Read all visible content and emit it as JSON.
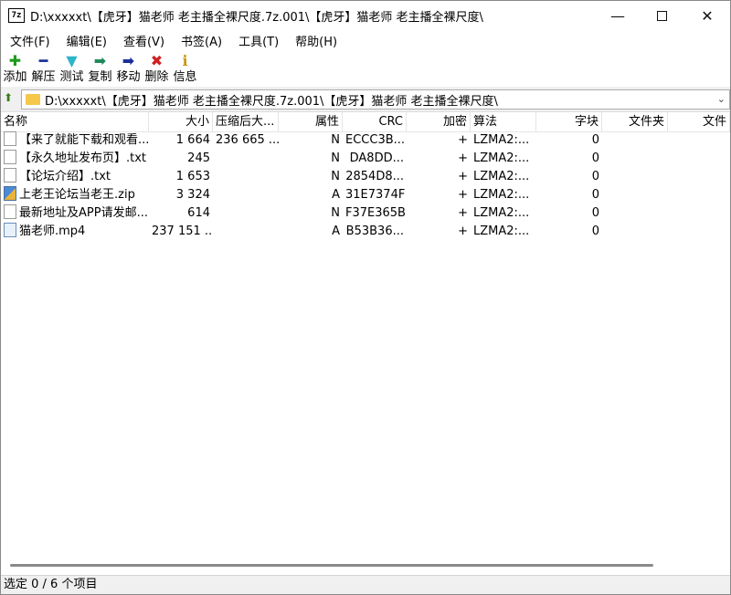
{
  "window": {
    "app_icon": "7z",
    "title": "D:\\xxxxxt\\【虎牙】猫老师 老主播全裸尺度.7z.001\\【虎牙】猫老师 老主播全裸尺度\\",
    "minimize_icon": "minimize-icon",
    "maximize_icon": "maximize-icon",
    "close_icon": "close-icon"
  },
  "menu": [
    "文件(F)",
    "编辑(E)",
    "查看(V)",
    "书签(A)",
    "工具(T)",
    "帮助(H)"
  ],
  "toolbar": [
    {
      "label": "添加",
      "icon": "plus-icon",
      "glyph": "✚",
      "color": "#1e9a1e"
    },
    {
      "label": "解压",
      "icon": "minus-icon",
      "glyph": "━",
      "color": "#1a2f9a"
    },
    {
      "label": "测试",
      "icon": "check-icon",
      "glyph": "▼",
      "color": "#2fb4c8"
    },
    {
      "label": "复制",
      "icon": "copy-arrow-icon",
      "glyph": "➡",
      "color": "#1e8a5a"
    },
    {
      "label": "移动",
      "icon": "move-arrow-icon",
      "glyph": "➡",
      "color": "#1a2f9a"
    },
    {
      "label": "删除",
      "icon": "delete-icon",
      "glyph": "✖",
      "color": "#d02020"
    },
    {
      "label": "信息",
      "icon": "info-icon",
      "glyph": "ℹ",
      "color": "#c89a10"
    }
  ],
  "address": {
    "path": "D:\\xxxxxt\\【虎牙】猫老师 老主播全裸尺度.7z.001\\【虎牙】猫老师 老主播全裸尺度\\"
  },
  "columns": [
    "名称",
    "大小",
    "压缩后大...",
    "属性",
    "CRC",
    "加密",
    "算法",
    "字块",
    "文件夹",
    "文件"
  ],
  "files": [
    {
      "name": "【来了就能下载和观看...",
      "icon": "text-file-icon",
      "size": "1 664",
      "packed": "236 665 ...",
      "attr": "N",
      "crc": "ECCC3B...",
      "enc": "+",
      "method": "LZMA2:...",
      "block": "0"
    },
    {
      "name": "【永久地址发布页】.txt",
      "icon": "text-file-icon",
      "size": "245",
      "packed": "",
      "attr": "N",
      "crc": "DA8DD...",
      "enc": "+",
      "method": "LZMA2:...",
      "block": "0"
    },
    {
      "name": "【论坛介绍】.txt",
      "icon": "text-file-icon",
      "size": "1 653",
      "packed": "",
      "attr": "N",
      "crc": "2854D8...",
      "enc": "+",
      "method": "LZMA2:...",
      "block": "0"
    },
    {
      "name": "上老王论坛当老王.zip",
      "icon": "zip-file-icon",
      "size": "3 324",
      "packed": "",
      "attr": "A",
      "crc": "31E7374F",
      "enc": "+",
      "method": "LZMA2:...",
      "block": "0"
    },
    {
      "name": "最新地址及APP请发邮...",
      "icon": "text-file-icon",
      "size": "614",
      "packed": "",
      "attr": "N",
      "crc": "F37E365B",
      "enc": "+",
      "method": "LZMA2:...",
      "block": "0"
    },
    {
      "name": "猫老师.mp4",
      "icon": "video-file-icon",
      "size": "237 151 ...",
      "packed": "",
      "attr": "A",
      "crc": "B53B36...",
      "enc": "+",
      "method": "LZMA2:...",
      "block": "0"
    }
  ],
  "status": "选定 0 / 6 个项目"
}
